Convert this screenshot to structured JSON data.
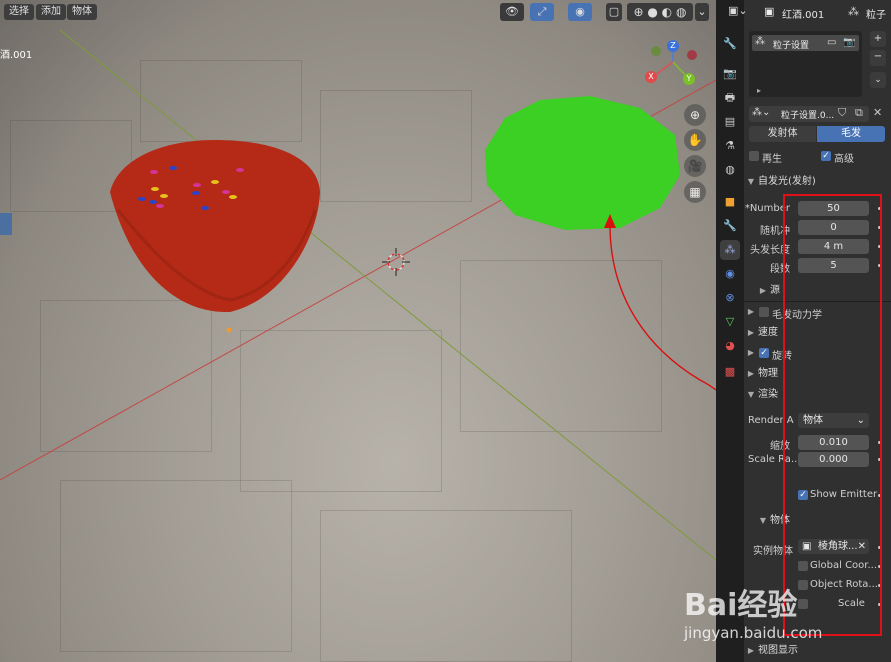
{
  "viewport": {
    "menu": {
      "select": "选择",
      "add": "添加",
      "object": "物体"
    },
    "object_name_clip": "酒.001",
    "axis_labels": {
      "x": "X",
      "y": "Y",
      "z": "Z"
    }
  },
  "panel": {
    "header_object": "红酒.001",
    "header_particle": "粒子",
    "slot_name": "粒子设置",
    "system_name": "粒子设置.0...",
    "type_tabs": [
      "发射体",
      "毛发"
    ],
    "active_type": "毛发",
    "checks": {
      "regrow": "再生",
      "advanced": "高级"
    },
    "emission": {
      "title": "自发光(发射)",
      "rows": [
        {
          "label": "*Number",
          "value": "50"
        },
        {
          "label": "随机冲",
          "value": "0"
        },
        {
          "label": "头发长度",
          "value": "4 m"
        },
        {
          "label": "段数",
          "value": "5"
        }
      ]
    },
    "sections": {
      "source": "源",
      "hair_dynamics": "毛发动力学",
      "velocity": "速度",
      "rotation": "旋转",
      "physics": "物理",
      "render": "渲染",
      "viewport_display": "视图显示"
    },
    "render": {
      "render_as_label": "Render A",
      "render_as_value": "物体",
      "scale_label": "缩放",
      "scale_value": "0.010",
      "scale_random_label": "Scale Ra...",
      "scale_random_value": "0.000",
      "show_emitter": "Show Emitter",
      "object_sub": "物体",
      "instance_label": "实例物体",
      "instance_value": "棱角球...",
      "global_coord": "Global Coor...",
      "object_rotation": "Object Rota...",
      "object_scale": "Scale"
    }
  },
  "watermark": {
    "brand": "Bai经验",
    "url": "jingyan.baidu.com"
  },
  "colors": {
    "accent": "#4772b3",
    "bowl": "#b52a17",
    "disc": "#3ccf24",
    "annotation": "#e0101a"
  }
}
